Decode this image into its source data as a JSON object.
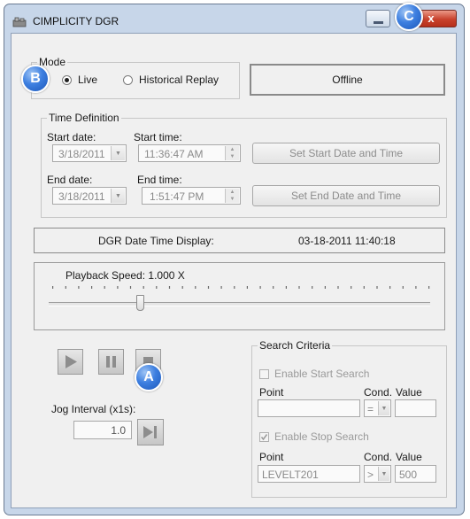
{
  "window": {
    "title": "CIMPLICITY DGR",
    "close_label": "x"
  },
  "mode": {
    "group_label": "Mode",
    "live_label": "Live",
    "replay_label": "Historical Replay",
    "selected": "Live",
    "status": "Offline"
  },
  "time_definition": {
    "group_label": "Time Definition",
    "start_date_label": "Start date:",
    "start_date": "3/18/2011",
    "start_time_label": "Start time:",
    "start_time": "11:36:47 AM",
    "set_start_button": "Set Start Date and Time",
    "end_date_label": "End date:",
    "end_date": "3/18/2011",
    "end_time_label": "End time:",
    "end_time": "1:51:47 PM",
    "set_end_button": "Set End Date and Time"
  },
  "display": {
    "label": "DGR Date Time Display:",
    "value": "03-18-2011 11:40:18"
  },
  "playback": {
    "label": "Playback Speed: 1.000 X",
    "tick_count": 30,
    "slider_position_fraction": 0.24
  },
  "controls": {
    "jog_label": "Jog Interval (x1s):",
    "jog_value": "1.0"
  },
  "search": {
    "group_label": "Search Criteria",
    "enable_start_label": "Enable Start Search",
    "enable_start_checked": false,
    "start_point_label": "Point",
    "start_cond_label": "Cond.",
    "start_value_label": "Value",
    "start_point": "",
    "start_cond": "=",
    "start_value": "",
    "enable_stop_label": "Enable Stop Search",
    "enable_stop_checked": true,
    "stop_point_label": "Point",
    "stop_cond_label": "Cond.",
    "stop_value_label": "Value",
    "stop_point": "LEVELT201",
    "stop_cond": ">",
    "stop_value": "500"
  },
  "callouts": {
    "a": "A",
    "b": "B",
    "c": "C"
  },
  "colors": {
    "callout_blue": "#3d7fe0",
    "close_red": "#c8412c",
    "window_frame": "#c7d6e9"
  }
}
